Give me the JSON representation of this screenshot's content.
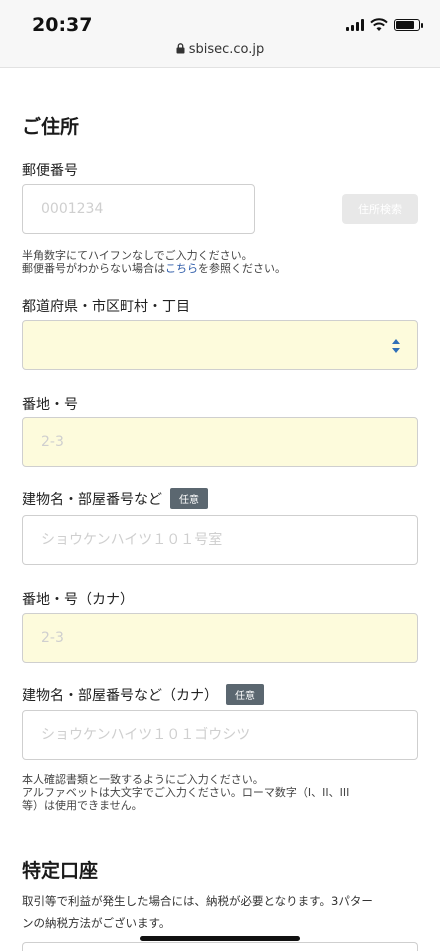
{
  "statusbar": {
    "time": "20:37",
    "url": "sbisec.co.jp",
    "battery_level": 0.8
  },
  "address": {
    "heading": "ご住所",
    "postal": {
      "label": "郵便番号",
      "placeholder": "0001234",
      "search_button": "住所検索",
      "help_line1": "半角数字にてハイフンなしでご入力ください。",
      "help_line2_before": "郵便番号がわからない場合は",
      "help_link": "こちら",
      "help_line2_after": "を参照ください。"
    },
    "prefecture": {
      "label": "都道府県・市区町村・丁目",
      "value": ""
    },
    "street": {
      "label": "番地・号",
      "placeholder": "2-3"
    },
    "building": {
      "label": "建物名・部屋番号など",
      "badge": "任意",
      "placeholder": "ショウケンハイツ１０１号室"
    },
    "street_kana": {
      "label": "番地・号（カナ）",
      "placeholder": "2-3"
    },
    "building_kana": {
      "label": "建物名・部屋番号など（カナ）",
      "badge": "任意",
      "placeholder": "ショウケンハイツ１０１ゴウシツ"
    },
    "note_line1": "本人確認書類と一致するようにご入力ください。",
    "note_line2": "アルファベットは大文字でご入力ください。ローマ数字（I、II、III",
    "note_line3": "等）は使用できません。"
  },
  "tokutei": {
    "heading": "特定口座",
    "desc_line1": "取引等で利益が発生した場合には、納税が必要となります。3パター",
    "desc_line2": "ンの納税方法がございます。"
  },
  "icons": {
    "lock": "lock-icon",
    "signal": "signal-icon",
    "wifi": "wifi-icon",
    "battery": "battery-icon",
    "select": "up-down-arrows-icon"
  },
  "colors": {
    "link": "#2c5aa8",
    "badge": "#5b6770",
    "required_field_bg": "#fdfbdc",
    "select_arrow": "#2f6fb8"
  }
}
